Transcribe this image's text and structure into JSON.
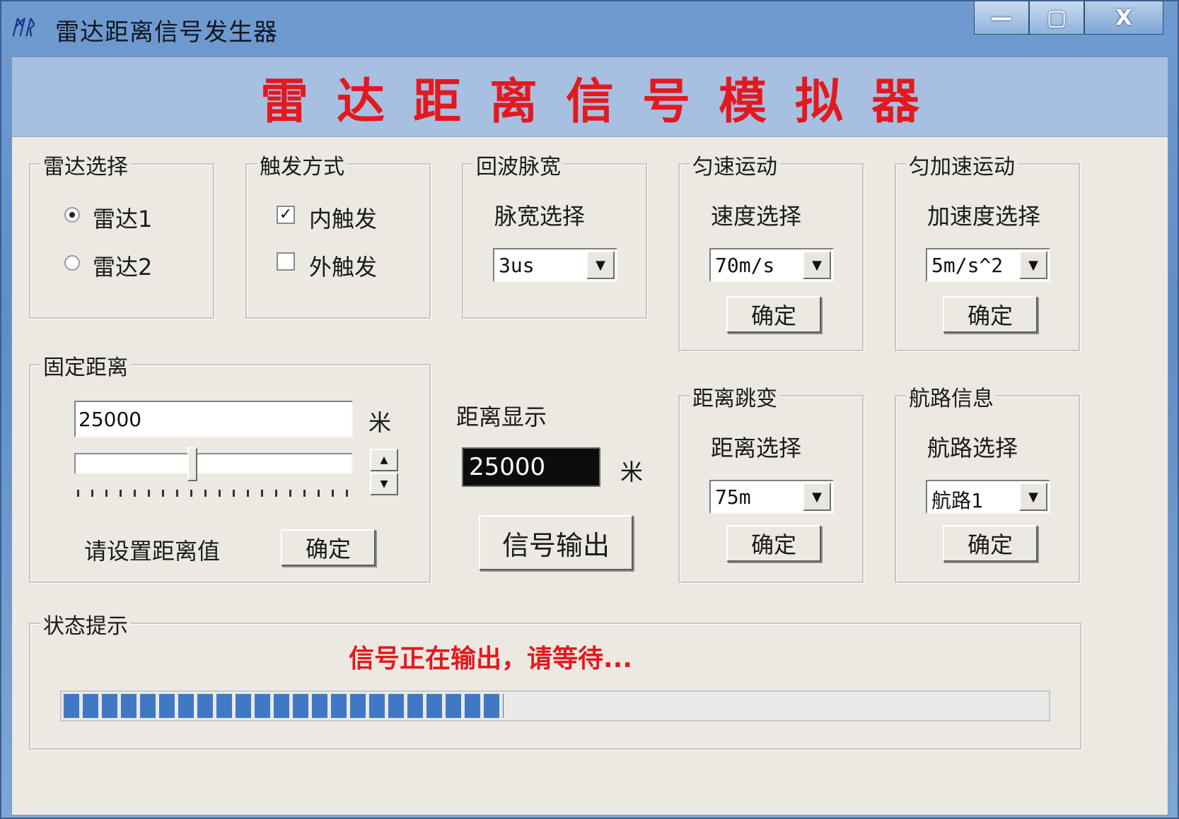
{
  "window": {
    "title": "雷达距离信号发生器",
    "icon": "app-icon",
    "controls": {
      "minimize": "—",
      "maximize": "▢",
      "close": "X"
    }
  },
  "banner": {
    "text": "雷达距离信号模拟器"
  },
  "radar_select": {
    "legend": "雷达选择",
    "options": [
      {
        "label": "雷达1",
        "selected": true
      },
      {
        "label": "雷达2",
        "selected": false
      }
    ]
  },
  "trigger_mode": {
    "legend": "触发方式",
    "options": [
      {
        "label": "内触发",
        "checked": true
      },
      {
        "label": "外触发",
        "checked": false
      }
    ],
    "check_mark": "✓"
  },
  "echo_pulse": {
    "legend": "回波脉宽",
    "label": "脉宽选择",
    "value": "3us"
  },
  "uniform_motion": {
    "legend": "匀速运动",
    "label": "速度选择",
    "value": "70m/s",
    "confirm": "确定"
  },
  "accel_motion": {
    "legend": "匀加速运动",
    "label": "加速度选择",
    "value": "5m/s^2",
    "confirm": "确定"
  },
  "fixed_distance": {
    "legend": "固定距离",
    "value": "25000",
    "unit": "米",
    "slider_position": 0.42,
    "hint": "请设置距离值",
    "confirm": "确定"
  },
  "distance_display": {
    "label": "距离显示",
    "value": "25000",
    "unit": "米",
    "output_button": "信号输出"
  },
  "distance_jump": {
    "legend": "距离跳变",
    "label": "距离选择",
    "value": "75m",
    "confirm": "确定"
  },
  "route_info": {
    "legend": "航路信息",
    "label": "航路选择",
    "value": "航路1",
    "confirm": "确定"
  },
  "status": {
    "legend": "状态提示",
    "message": "信号正在输出，请等待...",
    "progress": 0.45
  },
  "colors": {
    "banner_text": "#e2191f",
    "status_text": "#e2191f",
    "progress_fill": "#3f79c4",
    "banner_bg": "#a7bfe0"
  },
  "glyphs": {
    "dropdown": "▼",
    "spin_up": "▲",
    "spin_down": "▼"
  }
}
